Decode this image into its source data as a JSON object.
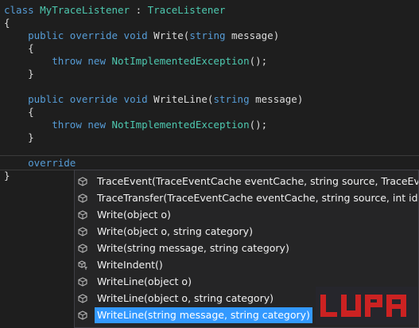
{
  "code": {
    "lines": [
      [
        {
          "t": "class ",
          "c": "kw"
        },
        {
          "t": "MyTraceListener",
          "c": "ty"
        },
        {
          "t": " : ",
          "c": "pl"
        },
        {
          "t": "TraceListener",
          "c": "ty"
        }
      ],
      [
        {
          "t": "{",
          "c": "pl"
        }
      ],
      [
        {
          "t": "    ",
          "c": "pl"
        },
        {
          "t": "public",
          "c": "kw"
        },
        {
          "t": " ",
          "c": "pl"
        },
        {
          "t": "override",
          "c": "kw"
        },
        {
          "t": " ",
          "c": "pl"
        },
        {
          "t": "void",
          "c": "kw"
        },
        {
          "t": " Write(",
          "c": "pl"
        },
        {
          "t": "string",
          "c": "kw"
        },
        {
          "t": " message)",
          "c": "pl"
        }
      ],
      [
        {
          "t": "    {",
          "c": "pl"
        }
      ],
      [
        {
          "t": "        ",
          "c": "pl"
        },
        {
          "t": "throw",
          "c": "kw"
        },
        {
          "t": " ",
          "c": "pl"
        },
        {
          "t": "new",
          "c": "kw"
        },
        {
          "t": " ",
          "c": "pl"
        },
        {
          "t": "NotImplementedException",
          "c": "ty"
        },
        {
          "t": "();",
          "c": "pl"
        }
      ],
      [
        {
          "t": "    }",
          "c": "pl"
        }
      ],
      [
        {
          "t": "",
          "c": "pl"
        }
      ],
      [
        {
          "t": "    ",
          "c": "pl"
        },
        {
          "t": "public",
          "c": "kw"
        },
        {
          "t": " ",
          "c": "pl"
        },
        {
          "t": "override",
          "c": "kw"
        },
        {
          "t": " ",
          "c": "pl"
        },
        {
          "t": "void",
          "c": "kw"
        },
        {
          "t": " WriteLine(",
          "c": "pl"
        },
        {
          "t": "string",
          "c": "kw"
        },
        {
          "t": " message)",
          "c": "pl"
        }
      ],
      [
        {
          "t": "    {",
          "c": "pl"
        }
      ],
      [
        {
          "t": "        ",
          "c": "pl"
        },
        {
          "t": "throw",
          "c": "kw"
        },
        {
          "t": " ",
          "c": "pl"
        },
        {
          "t": "new",
          "c": "kw"
        },
        {
          "t": " ",
          "c": "pl"
        },
        {
          "t": "NotImplementedException",
          "c": "ty"
        },
        {
          "t": "();",
          "c": "pl"
        }
      ],
      [
        {
          "t": "    }",
          "c": "pl"
        }
      ],
      [
        {
          "t": "",
          "c": "pl"
        }
      ],
      [
        {
          "t": "    ",
          "c": "pl"
        },
        {
          "t": "override",
          "c": "kw"
        }
      ],
      [
        {
          "t": "}",
          "c": "pl"
        }
      ]
    ]
  },
  "completion": {
    "items": [
      {
        "label": "TraceEvent(TraceEventCache eventCache, string source, TraceEventTyp",
        "icon": "method-icon"
      },
      {
        "label": "TraceTransfer(TraceEventCache eventCache, string source, int id, string",
        "icon": "method-icon"
      },
      {
        "label": "Write(object o)",
        "icon": "method-icon"
      },
      {
        "label": "Write(object o, string category)",
        "icon": "method-icon"
      },
      {
        "label": "Write(string message, string category)",
        "icon": "method-icon"
      },
      {
        "label": "WriteIndent()",
        "icon": "protected-method-icon"
      },
      {
        "label": "WriteLine(object o)",
        "icon": "method-icon"
      },
      {
        "label": "WriteLine(object o, string category)",
        "icon": "method-icon"
      },
      {
        "label": "WriteLine(string message, string category)",
        "icon": "method-icon"
      }
    ],
    "selected_index": 8
  },
  "watermark": {
    "text": "LUPA",
    "color": "#cc2222"
  },
  "colors": {
    "keyword": "#569cd6",
    "type": "#4ec9b0",
    "plain": "#dcdcdc",
    "selection": "#3399ff",
    "background": "#1e1e1e"
  }
}
